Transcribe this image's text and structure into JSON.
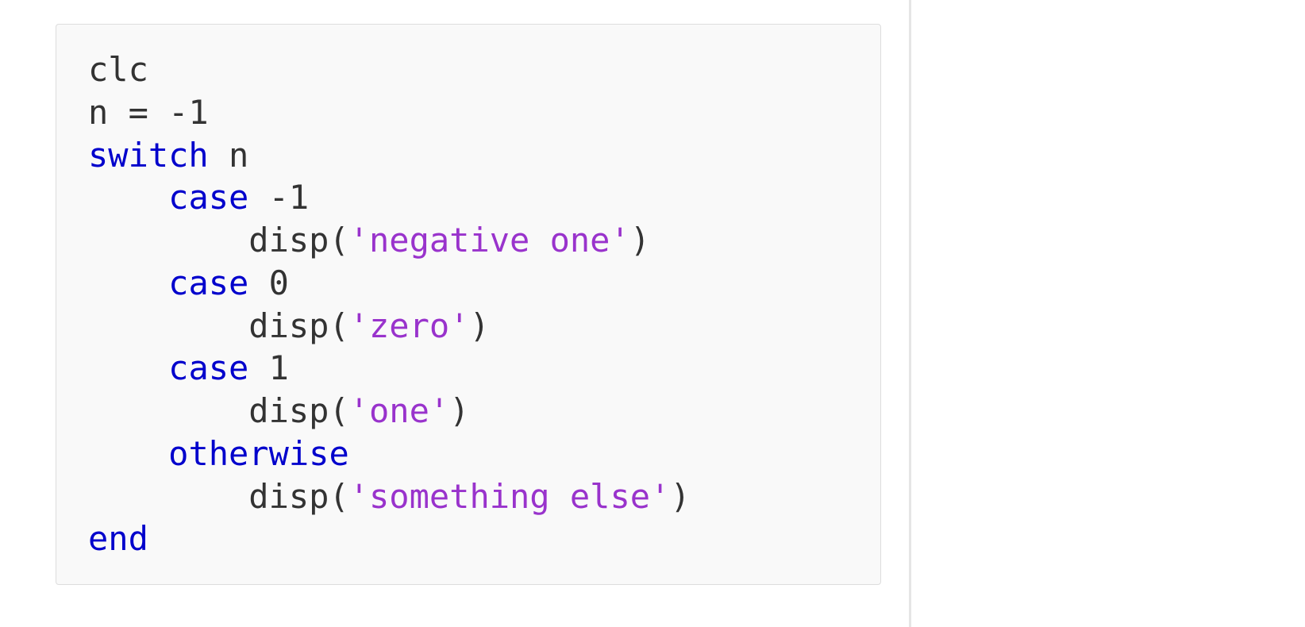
{
  "code": {
    "lines": [
      {
        "indent": 0,
        "tokens": [
          {
            "type": "plain",
            "text": "clc"
          }
        ]
      },
      {
        "indent": 0,
        "tokens": [
          {
            "type": "plain",
            "text": "n = -1"
          }
        ]
      },
      {
        "indent": 0,
        "tokens": [
          {
            "type": "keyword",
            "text": "switch"
          },
          {
            "type": "plain",
            "text": " n"
          }
        ]
      },
      {
        "indent": 1,
        "tokens": [
          {
            "type": "keyword",
            "text": "case"
          },
          {
            "type": "plain",
            "text": " -1"
          }
        ]
      },
      {
        "indent": 2,
        "tokens": [
          {
            "type": "plain",
            "text": "disp("
          },
          {
            "type": "string",
            "text": "'negative one'"
          },
          {
            "type": "plain",
            "text": ")"
          }
        ]
      },
      {
        "indent": 1,
        "tokens": [
          {
            "type": "keyword",
            "text": "case"
          },
          {
            "type": "plain",
            "text": " 0"
          }
        ]
      },
      {
        "indent": 2,
        "tokens": [
          {
            "type": "plain",
            "text": "disp("
          },
          {
            "type": "string",
            "text": "'zero'"
          },
          {
            "type": "plain",
            "text": ")"
          }
        ]
      },
      {
        "indent": 1,
        "tokens": [
          {
            "type": "keyword",
            "text": "case"
          },
          {
            "type": "plain",
            "text": " 1"
          }
        ]
      },
      {
        "indent": 2,
        "tokens": [
          {
            "type": "plain",
            "text": "disp("
          },
          {
            "type": "string",
            "text": "'one'"
          },
          {
            "type": "plain",
            "text": ")"
          }
        ]
      },
      {
        "indent": 1,
        "tokens": [
          {
            "type": "keyword",
            "text": "otherwise"
          }
        ]
      },
      {
        "indent": 2,
        "tokens": [
          {
            "type": "plain",
            "text": "disp("
          },
          {
            "type": "string",
            "text": "'something else'"
          },
          {
            "type": "plain",
            "text": ")"
          }
        ]
      },
      {
        "indent": 0,
        "tokens": [
          {
            "type": "keyword",
            "text": "end"
          }
        ]
      }
    ],
    "indentUnit": "    "
  },
  "colors": {
    "keyword": "#0000cc",
    "string": "#9933cc",
    "plain": "#333333",
    "codeBg": "#f9f9f9",
    "codeBorder": "#dddddd",
    "divider": "#e5e5e5"
  }
}
